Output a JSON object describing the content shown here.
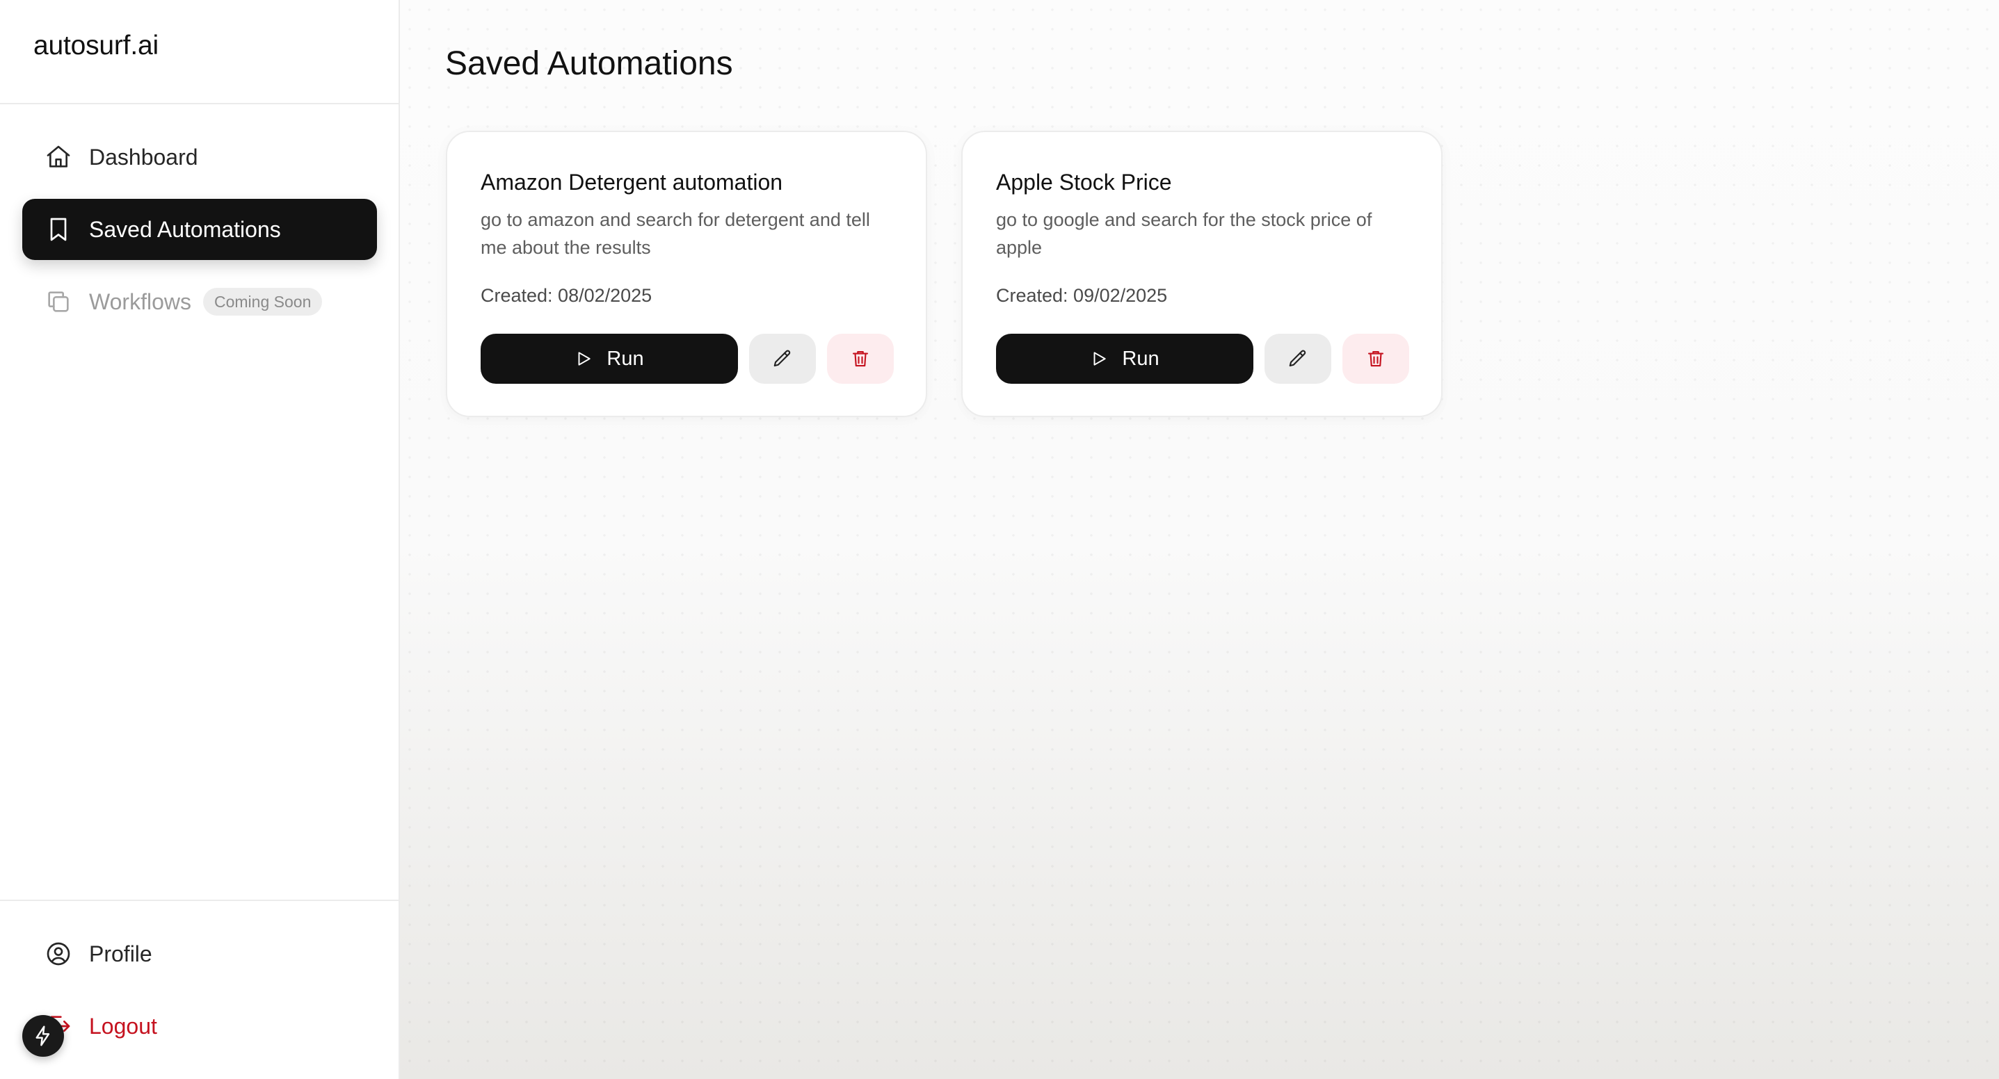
{
  "brand": "autosurf.ai",
  "nav": {
    "dashboard": "Dashboard",
    "saved": "Saved Automations",
    "workflows": "Workflows",
    "workflows_badge": "Coming Soon",
    "profile": "Profile",
    "logout": "Logout"
  },
  "page": {
    "title": "Saved Automations"
  },
  "automations": [
    {
      "title": "Amazon Detergent automation",
      "description": "go to amazon and search for detergent and tell me about the results",
      "created": "Created: 08/02/2025",
      "run_label": "Run"
    },
    {
      "title": "Apple Stock Price",
      "description": "go to google and search for the stock price of apple",
      "created": "Created: 09/02/2025",
      "run_label": "Run"
    }
  ],
  "colors": {
    "active_nav": "#121212",
    "logout": "#c5121f",
    "delete": "#c5121f",
    "delete_bg": "#fdecee"
  },
  "icons": [
    "home-icon",
    "bookmark-icon",
    "copy-icon",
    "user-circle-icon",
    "logout-icon",
    "bolt-icon",
    "play-icon",
    "pencil-icon",
    "trash-icon"
  ]
}
